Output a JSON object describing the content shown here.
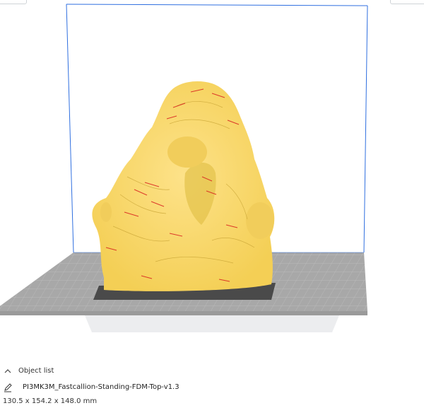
{
  "viewport": {
    "model_color": "#f9d96a",
    "overhang_color": "#d81e1e",
    "bed_color": "#a6a6a6",
    "volume_line_color": "#2f6fe0"
  },
  "object_list": {
    "toggle_icon": "chevron-up-icon",
    "label": "Object list",
    "edit_icon": "pencil-icon",
    "file_name": "PI3MK3M_Fastcallion-Standing-FDM-Top-v1.3",
    "dimensions": "130.5 x 154.2 x 148.0 mm"
  }
}
